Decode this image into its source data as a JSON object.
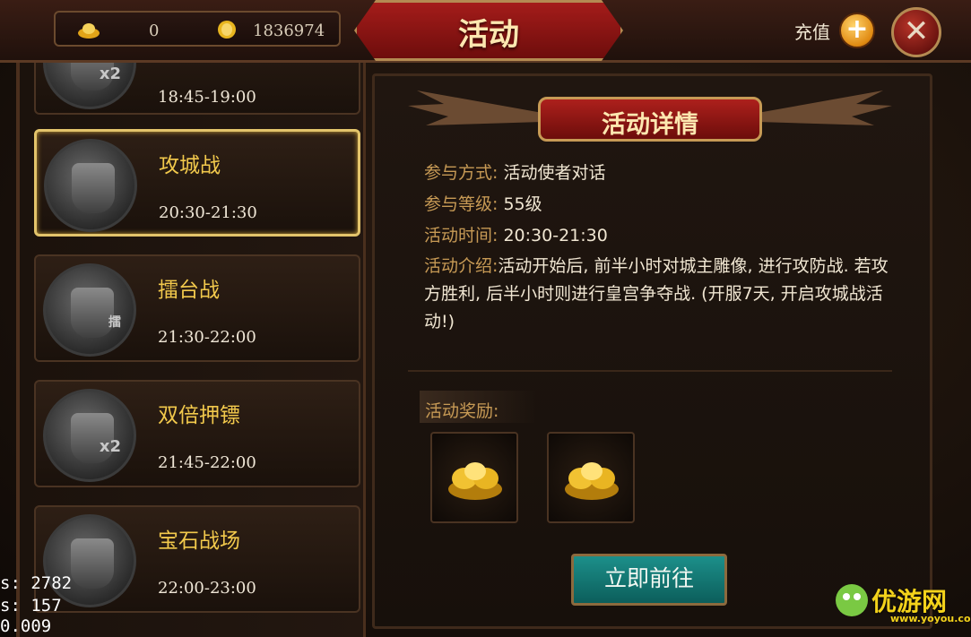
{
  "header": {
    "title": "活动",
    "ingot_count": "0",
    "gold_count": "1836974",
    "recharge_label": "充值",
    "plus_glyph": "+",
    "close_glyph": "✕"
  },
  "activities": [
    {
      "name": "",
      "time": "18:45-19:00",
      "icon": "partial-icon",
      "tag": "x2"
    },
    {
      "name": "攻城战",
      "time": "20:30-21:30",
      "icon": "siege-armor-icon",
      "tag": ""
    },
    {
      "name": "擂台战",
      "time": "21:30-22:00",
      "icon": "arena-ring-icon",
      "tag": "擂"
    },
    {
      "name": "双倍押镖",
      "time": "21:45-22:00",
      "icon": "escort-horse-icon",
      "tag": "x2"
    },
    {
      "name": "宝石战场",
      "time": "22:00-23:00",
      "icon": "gem-shield-icon",
      "tag": ""
    }
  ],
  "detail": {
    "title": "活动详情",
    "method_label": "参与方式:",
    "method_value": "活动使者对话",
    "level_label": "参与等级:",
    "level_value": "55级",
    "time_label": "活动时间:",
    "time_value": "20:30-21:30",
    "intro_label": "活动介绍:",
    "intro_value": "活动开始后, 前半小时对城主雕像, 进行攻防战. 若攻方胜利, 后半小时则进行皇宫争夺战. (开服7天, 开启攻城战活动!)",
    "reward_label": "活动奖励:",
    "rewards": [
      "gold-ingot-icon",
      "gold-ingot-icon"
    ],
    "go_button": "立即前往"
  },
  "debug": {
    "line1": "s:   2782",
    "line2": "s:    157",
    "line3": "0.009"
  },
  "watermark": {
    "text": "优游网",
    "url": "www.yoyou.com"
  },
  "colors": {
    "gold_text": "#f2c94c",
    "label_brown": "#c79a55",
    "title_red": "#a41c1a",
    "button_teal": "#1c8f8a"
  }
}
